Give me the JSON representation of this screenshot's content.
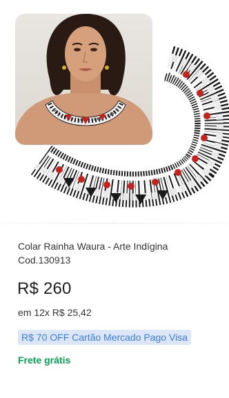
{
  "product": {
    "title_line1": "Colar Rainha Waura - Arte Indígina",
    "title_line2": "Cod.130913",
    "price": "R$ 260",
    "installments": "em 12x R$ 25,42",
    "promo": "R$ 70 OFF Cartão Mercado Pago Visa",
    "shipping": "Frete grátis"
  },
  "colors": {
    "promo_text": "#3a7fe0",
    "promo_background": "#dce6f7",
    "shipping_green": "#00a650",
    "bead_red": "#c8221e",
    "bead_black": "#1a1a1a"
  },
  "icons": {
    "image": "product-photo"
  }
}
